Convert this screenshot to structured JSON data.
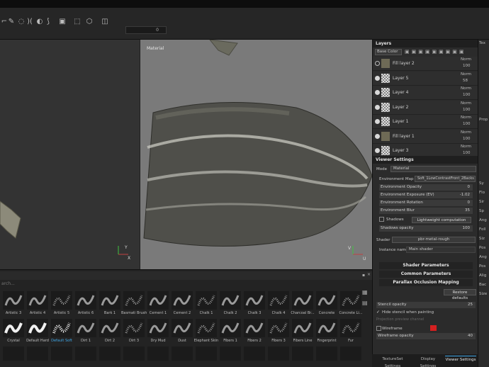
{
  "toolbar": {
    "icons": [
      "brush-icon",
      "eraser-icon",
      "projection-icon",
      "geometry-icon",
      "smudge-icon",
      "clone-icon",
      "bake-icon",
      "symmetry-icon",
      "lazy-icon",
      "camera-icon"
    ],
    "field_value": "0"
  },
  "viewport3d": {
    "label": ""
  },
  "viewport2d": {
    "label": "Material"
  },
  "shelf": {
    "search_placeholder": "arch...",
    "rows": [
      [
        "Artistic 3",
        "Artistic 4",
        "Artistic 5",
        "Artistic 6",
        "Bark 1",
        "Basmati Brush",
        "Cement 1",
        "Cement 2",
        "Chalk 1",
        "Chalk 2",
        "Chalk 3",
        "Chalk 4",
        "Charcoal Br...",
        "Concrete",
        "Concrete Li..."
      ],
      [
        "Crystal",
        "Default Hard",
        "Default Soft",
        "Dirt 1",
        "Dirt 2",
        "Dirt 3",
        "Dry Mud",
        "Dust",
        "Elephant Skin",
        "Fibers 1",
        "Fibers 2",
        "Fibers 3",
        "Fibers Line",
        "Fingerprint",
        "Fur"
      ]
    ],
    "selected": "Default Soft"
  },
  "layers": {
    "title": "Layers",
    "channel": "Base Color",
    "items": [
      {
        "name": "Fill layer 2",
        "blend": "Norm",
        "opacity": "100",
        "visible": false,
        "type": "fill"
      },
      {
        "name": "Layer 5",
        "blend": "Norm",
        "opacity": "58",
        "visible": true,
        "type": "paint"
      },
      {
        "name": "Layer 4",
        "blend": "Norm",
        "opacity": "100",
        "visible": true,
        "type": "paint"
      },
      {
        "name": "Layer 2",
        "blend": "Norm",
        "opacity": "100",
        "visible": true,
        "type": "paint"
      },
      {
        "name": "Layer 1",
        "blend": "Norm",
        "opacity": "100",
        "visible": true,
        "type": "paint"
      },
      {
        "name": "Fill layer 1",
        "blend": "Norm",
        "opacity": "100",
        "visible": true,
        "type": "fill"
      },
      {
        "name": "Layer 3",
        "blend": "Norm",
        "opacity": "100",
        "visible": true,
        "type": "paint"
      }
    ]
  },
  "viewer": {
    "title": "Viewer Settings",
    "mode_label": "Mode",
    "mode_value": "Material",
    "env_map_label": "Environment Map",
    "env_map_value": "Soft_1LowContrastFront_2Backs",
    "sliders": [
      {
        "label": "Environment Opacity",
        "value": "0"
      },
      {
        "label": "Environment Exposure (EV)",
        "value": "-1.02"
      },
      {
        "label": "Environment Rotation",
        "value": "0"
      },
      {
        "label": "Environment Blur",
        "value": "35"
      }
    ],
    "shadows_label": "Shadows",
    "shadows_btn": "Lightweight computation",
    "shadows_opacity_label": "Shadows opacity",
    "shadows_opacity_value": "100",
    "shader_label": "Shader",
    "shader_value": "pbr-metal-rough",
    "instance_label": "Instance name",
    "instance_value": "Main shader",
    "sections": [
      "Shader Parameters",
      "Common Parameters",
      "Parallax Occlusion Mapping"
    ],
    "restore_btn": "Restore defaults",
    "stencil_label": "Stencil opacity",
    "stencil_value": "25",
    "hide_stencil_label": "Hide stencil when painting",
    "projection_label": "Projection preview channel",
    "wireframe_label": "Wireframe",
    "wireframe_color": "#d42020",
    "wireframe_opacity_label": "Wireframe opacity",
    "wireframe_opacity_value": "40"
  },
  "bottom_tabs": [
    "TextureSet Settings",
    "Display Settings",
    "Viewer Settings"
  ],
  "right_strip": {
    "top_label": "Tex",
    "mid_label": "Prop",
    "items": [
      "Sy",
      "Flo",
      "Sir",
      "Sp",
      "Ang",
      "Foll",
      "Siz",
      "Pos",
      "Ang",
      "Pos",
      "Alig",
      "Bac",
      "Size"
    ]
  }
}
